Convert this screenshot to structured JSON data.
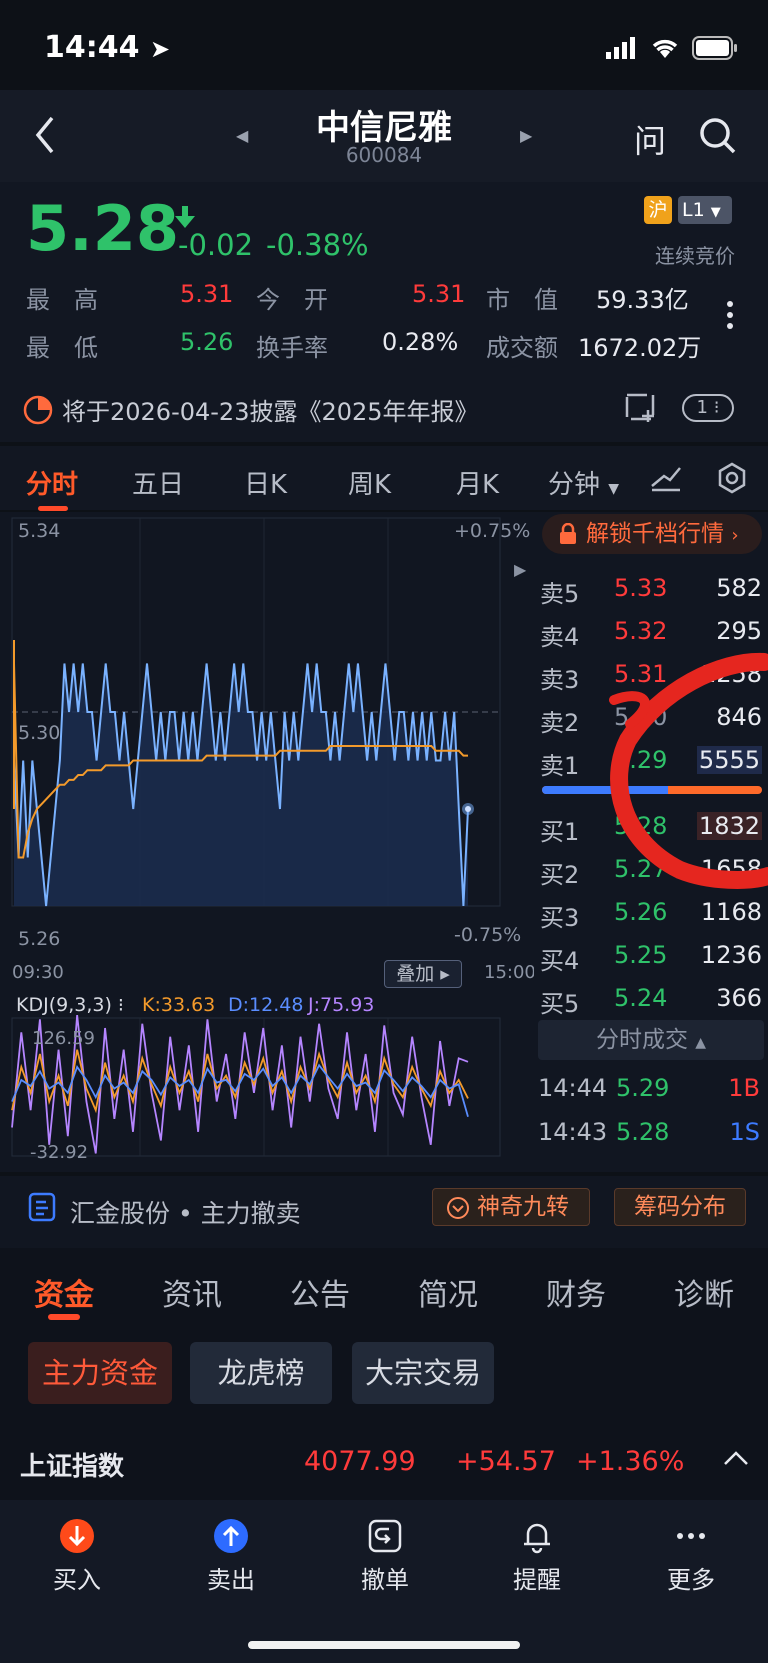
{
  "status_bar": {
    "time": "14:44"
  },
  "header": {
    "title": "中信尼雅",
    "code": "600084",
    "ask_label": "问"
  },
  "quote": {
    "price": "5.28",
    "change": "-0.02",
    "change_pct": "-0.38%",
    "badge_market": "沪",
    "badge_level": "L1",
    "session": "连续竞价",
    "stats": [
      {
        "label": "最　高",
        "value": "5.31"
      },
      {
        "label": "今　开",
        "value": "5.31"
      },
      {
        "label": "市　值",
        "value": "59.33亿"
      },
      {
        "label": "最　低",
        "value": "5.26"
      },
      {
        "label": "换手率",
        "value": "0.28%"
      },
      {
        "label": "成交额",
        "value": "1672.02万"
      }
    ],
    "notice": "将于2026-04-23披露《2025年年报》",
    "notice_count": "1"
  },
  "chart_tabs": [
    "分时",
    "五日",
    "日K",
    "周K",
    "月K",
    "分钟"
  ],
  "chart_data": [
    {
      "type": "line",
      "title": "",
      "x_range": [
        "09:30",
        "15:00"
      ],
      "ylim": [
        5.26,
        5.34
      ],
      "y_labels": [
        "5.34",
        "5.30",
        "5.26"
      ],
      "pct_labels": [
        "+0.75%",
        "-0.75%"
      ],
      "reference_price": 5.3,
      "series": [
        {
          "name": "",
          "color": "#7ab2ff",
          "values": [
            5.29,
            5.27,
            5.29,
            5.27,
            5.29,
            5.28,
            5.27,
            5.26,
            5.27,
            5.28,
            5.29,
            5.31,
            5.3,
            5.31,
            5.3,
            5.31,
            5.3,
            5.3,
            5.29,
            5.3,
            5.31,
            5.3,
            5.3,
            5.29,
            5.3,
            5.29,
            5.28,
            5.29,
            5.3,
            5.31,
            5.3,
            5.29,
            5.3,
            5.29,
            5.3,
            5.3,
            5.29,
            5.3,
            5.29,
            5.3,
            5.29,
            5.3,
            5.31,
            5.3,
            5.29,
            5.3,
            5.29,
            5.3,
            5.31,
            5.3,
            5.31,
            5.3,
            5.3,
            5.29,
            5.3,
            5.29,
            5.3,
            5.29,
            5.28,
            5.3,
            5.29,
            5.3,
            5.29,
            5.3,
            5.31,
            5.3,
            5.31,
            5.3,
            5.3,
            5.29,
            5.3,
            5.29,
            5.3,
            5.31,
            5.3,
            5.31,
            5.3,
            5.29,
            5.3,
            5.29,
            5.3,
            5.31,
            5.3,
            5.29,
            5.3,
            5.3,
            5.29,
            5.3,
            5.29,
            5.3,
            5.29,
            5.3,
            5.29,
            5.29,
            5.3,
            5.29,
            5.3,
            5.28,
            5.26,
            5.28
          ]
        },
        {
          "name": "",
          "color": "#f39a2b",
          "values": [
            5.31,
            5.27,
            5.27,
            5.275,
            5.278,
            5.28,
            5.281,
            5.282,
            5.283,
            5.284,
            5.285,
            5.285,
            5.286,
            5.286,
            5.287,
            5.287,
            5.288,
            5.288,
            5.288,
            5.288,
            5.289,
            5.289,
            5.289,
            5.289,
            5.289,
            5.289,
            5.29,
            5.29,
            5.29,
            5.29,
            5.29,
            5.29,
            5.29,
            5.29,
            5.29,
            5.29,
            5.29,
            5.29,
            5.29,
            5.29,
            5.29,
            5.29,
            5.291,
            5.291,
            5.291,
            5.291,
            5.291,
            5.291,
            5.291,
            5.291,
            5.291,
            5.291,
            5.291,
            5.291,
            5.291,
            5.291,
            5.291,
            5.291,
            5.292,
            5.292,
            5.292,
            5.292,
            5.292,
            5.292,
            5.292,
            5.292,
            5.292,
            5.292,
            5.292,
            5.293,
            5.293,
            5.293,
            5.293,
            5.293,
            5.293,
            5.293,
            5.293,
            5.293,
            5.293,
            5.293,
            5.293,
            5.293,
            5.293,
            5.293,
            5.293,
            5.293,
            5.293,
            5.293,
            5.293,
            5.293,
            5.293,
            5.293,
            5.292,
            5.292,
            5.292,
            5.292,
            5.292,
            5.292,
            5.291,
            5.291
          ]
        }
      ],
      "overlay_button": "叠加"
    },
    {
      "type": "line",
      "title": "KDJ(9,3,3)",
      "y_labels": [
        "126.59",
        "-32.92"
      ],
      "ylim": [
        -32.92,
        126.59
      ],
      "series": [
        {
          "name": "K:33.63",
          "color": "#f39a2b",
          "values": [
            20,
            70,
            40,
            85,
            30,
            60,
            25,
            90,
            45,
            20,
            75,
            35,
            60,
            30,
            80,
            50,
            25,
            70,
            40,
            65,
            30,
            85,
            45,
            60,
            35,
            75,
            50,
            80,
            40,
            65,
            30,
            70,
            45,
            85,
            55,
            35,
            75,
            40,
            60,
            30,
            80,
            50,
            35,
            70,
            45,
            25,
            65,
            40,
            55,
            33.63
          ]
        },
        {
          "name": "D:12.48",
          "color": "#5a8dff",
          "values": [
            30,
            55,
            48,
            65,
            45,
            52,
            40,
            70,
            55,
            35,
            60,
            45,
            52,
            40,
            65,
            55,
            38,
            58,
            48,
            55,
            40,
            68,
            52,
            55,
            42,
            62,
            55,
            68,
            48,
            58,
            40,
            60,
            50,
            72,
            58,
            45,
            62,
            48,
            52,
            40,
            66,
            55,
            42,
            58,
            48,
            35,
            55,
            45,
            50,
            12.48
          ]
        },
        {
          "name": "J:75.93",
          "color": "#b585ff",
          "values": [
            0,
            110,
            20,
            125,
            -20,
            90,
            -10,
            130,
            30,
            -30,
            115,
            10,
            90,
            -5,
            120,
            40,
            -15,
            105,
            20,
            95,
            -5,
            125,
            30,
            85,
            10,
            110,
            40,
            115,
            20,
            95,
            0,
            105,
            30,
            120,
            45,
            10,
            110,
            20,
            85,
            -5,
            118,
            40,
            15,
            105,
            35,
            -20,
            100,
            25,
            80,
            75.93
          ]
        }
      ]
    }
  ],
  "orderbook": {
    "unlock_label": "解锁千档行情",
    "asks": [
      {
        "label": "卖5",
        "price": "5.33",
        "vol": "582"
      },
      {
        "label": "卖4",
        "price": "5.32",
        "vol": "295"
      },
      {
        "label": "卖3",
        "price": "5.31",
        "vol": "1258"
      },
      {
        "label": "卖2",
        "price": "5.30",
        "vol": "846"
      },
      {
        "label": "卖1",
        "price": "5.29",
        "vol": "5555"
      }
    ],
    "bids": [
      {
        "label": "买1",
        "price": "5.28",
        "vol": "1832"
      },
      {
        "label": "买2",
        "price": "5.27",
        "vol": "1658"
      },
      {
        "label": "买3",
        "price": "5.26",
        "vol": "1168"
      },
      {
        "label": "买4",
        "price": "5.25",
        "vol": "1236"
      },
      {
        "label": "买5",
        "price": "5.24",
        "vol": "366"
      }
    ],
    "trades_header": "分时成交",
    "trades": [
      {
        "time": "14:44",
        "price": "5.29",
        "size": "1B"
      },
      {
        "time": "14:43",
        "price": "5.28",
        "size": "1S"
      }
    ]
  },
  "tools": {
    "summary": "汇金股份 • 主力撤卖",
    "magic_label": "神奇九转",
    "chips_label": "筹码分布"
  },
  "section_tabs": [
    "资金",
    "资讯",
    "公告",
    "简况",
    "财务",
    "诊断"
  ],
  "sub_chips": [
    "主力资金",
    "龙虎榜",
    "大宗交易"
  ],
  "index_bar": {
    "name": "上证指数",
    "value": "4077.99",
    "change": "+54.57",
    "pct": "+1.36%"
  },
  "actions": [
    "买入",
    "卖出",
    "撤单",
    "提醒",
    "更多"
  ],
  "colors": {
    "up": "#ff3b3b",
    "down": "#2fc26a",
    "accent": "#ff4a2a",
    "price_line": "#7ab2ff",
    "avg_line": "#f39a2b"
  }
}
